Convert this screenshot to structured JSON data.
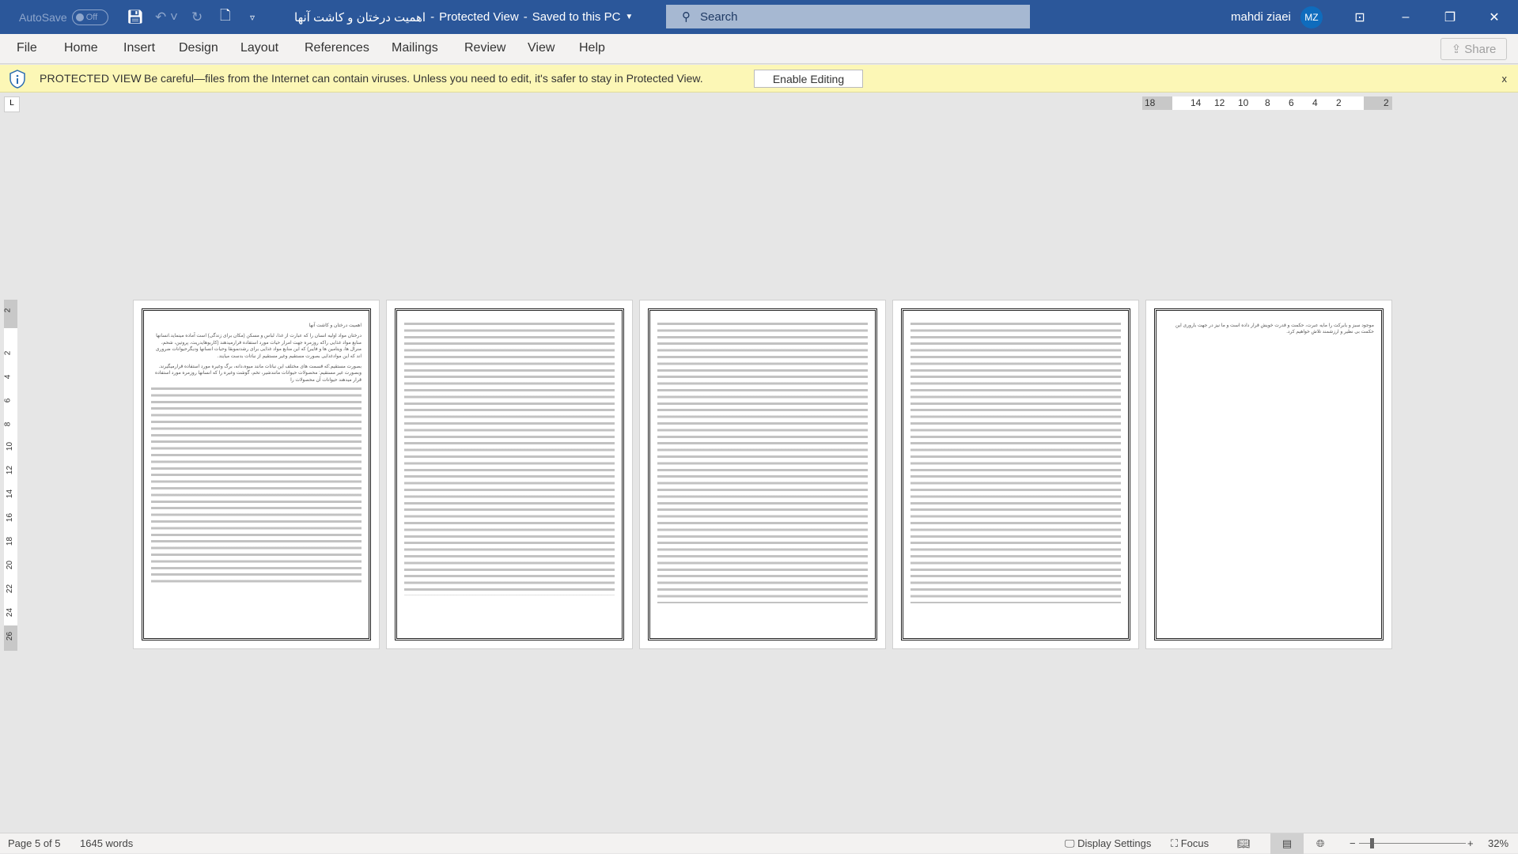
{
  "titlebar": {
    "autosave": "AutoSave",
    "autosave_state": "Off",
    "doc_name": "اهمیت درختان و کاشت آنها",
    "mode": "Protected View",
    "save_state": "Saved to this PC",
    "search_placeholder": "Search",
    "user_name": "mahdi ziaei",
    "user_initials": "MZ"
  },
  "ribbon": {
    "tabs": [
      "File",
      "Home",
      "Insert",
      "Design",
      "Layout",
      "References",
      "Mailings",
      "Review",
      "View",
      "Help"
    ],
    "share": "Share"
  },
  "protected_view": {
    "label": "PROTECTED VIEW",
    "message": "Be careful—files from the Internet can contain viruses. Unless you need to edit, it's safer to stay in Protected View.",
    "enable_button": "Enable Editing",
    "close": "x"
  },
  "ruler": {
    "horizontal": [
      "18",
      "14",
      "12",
      "10",
      "8",
      "6",
      "4",
      "2",
      "2"
    ],
    "vertical": [
      "2",
      "2",
      "4",
      "6",
      "8",
      "10",
      "12",
      "14",
      "16",
      "18",
      "20",
      "22",
      "24",
      "26"
    ]
  },
  "pages": [
    {
      "heading": "اهمیت درختان و کاشت آنها",
      "text": "درختان مواد اولیه انسان را که عبارت از غذا، لباس و مسکن (مکان برای زندگی) است آماده مینماید.انسانها منابع مواد غذایی راکه روزمره جهت امرار حیات مورد استفاده قرارمیدهند (کاربوهایدریت، پروتین، شحم، منرال ها، ویتامین ها و فایبر) که این منابع مواد غذایی برای رشدنموبقا وحیات انسانها ودیگرحیوانات ضروری اند که این موادغذایی بصورت مستقیم وغیر مستقیم از نباتات بدست میایند.",
      "text2": "بصورت مستقیم:که قسمت های مختلف این نباتات مانند میوه،دانه، برگ وغیره مورد استفاده قرارمیگیرند. وبصورت غیر مستقیم: محصولات حیوانات مانندشیر، تخم، گوشت وغیره را که انسانها روزمره مورد استفاده قرار میدهند حیوانات آن محصولات را"
    },
    {
      "heading": "",
      "text": ""
    },
    {
      "heading": "",
      "text": ""
    },
    {
      "heading": "",
      "text": ""
    },
    {
      "heading": "",
      "text": "موجود سبز و بابرکت را مایه عبرت، حکمت و قدرت خویش قرار داده است و ما نیز در جهت باروری این حکمت بی نظیر و ارزشمند تلاش خواهیم کرد."
    }
  ],
  "status": {
    "page": "Page 5 of 5",
    "words": "1645 words",
    "display_settings": "Display Settings",
    "focus": "Focus",
    "zoom": "32%",
    "zoom_level_percent": 32
  },
  "colors": {
    "titlebar": "#2b579a",
    "protected_bar": "#fcf7b6",
    "avatar": "#0f6cbd"
  }
}
